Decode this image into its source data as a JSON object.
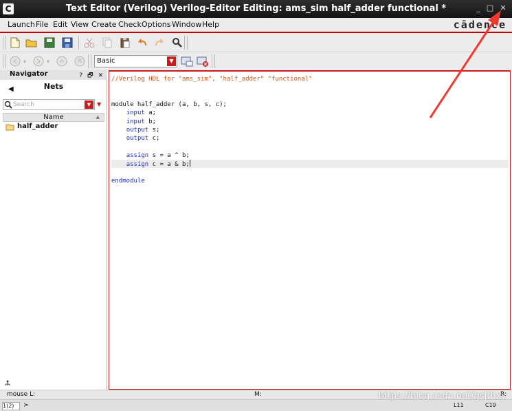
{
  "window": {
    "title": "Text Editor (Verilog) Verilog-Editor Editing: ams_sim half_adder functional *",
    "app_icon": "C"
  },
  "menubar": {
    "items": [
      "Launch",
      "File",
      "Edit",
      "View",
      "Create",
      "Check",
      "Options",
      "Window",
      "Help"
    ],
    "brand": "cādence"
  },
  "toolbar": {
    "view_mode": "Basic"
  },
  "navigator": {
    "title": "Navigator",
    "header_controls": "? 🗗 ✕",
    "section": "Nets",
    "search_placeholder": "Search",
    "column": "Name",
    "items": [
      "half_adder"
    ]
  },
  "editor": {
    "lines": [
      {
        "segments": [
          {
            "t": "//Verilog HDL for \"ams_sim\", \"half_adder\" \"functional\"",
            "c": "comment"
          }
        ]
      },
      {
        "segments": []
      },
      {
        "segments": []
      },
      {
        "segments": [
          {
            "t": "module half_adder (a, b, s, c);",
            "c": "plain"
          }
        ]
      },
      {
        "segments": [
          {
            "t": "    ",
            "c": "plain"
          },
          {
            "t": "input",
            "c": "kw"
          },
          {
            "t": " a;",
            "c": "plain"
          }
        ]
      },
      {
        "segments": [
          {
            "t": "    ",
            "c": "plain"
          },
          {
            "t": "input",
            "c": "kw"
          },
          {
            "t": " b;",
            "c": "plain"
          }
        ]
      },
      {
        "segments": [
          {
            "t": "    ",
            "c": "plain"
          },
          {
            "t": "output",
            "c": "kw"
          },
          {
            "t": " s;",
            "c": "plain"
          }
        ]
      },
      {
        "segments": [
          {
            "t": "    ",
            "c": "plain"
          },
          {
            "t": "output",
            "c": "kw"
          },
          {
            "t": " c;",
            "c": "plain"
          }
        ]
      },
      {
        "segments": []
      },
      {
        "segments": [
          {
            "t": "    ",
            "c": "plain"
          },
          {
            "t": "assign",
            "c": "kw"
          },
          {
            "t": " s = a ^ b;",
            "c": "plain"
          }
        ]
      },
      {
        "segments": [
          {
            "t": "    ",
            "c": "plain"
          },
          {
            "t": "assign",
            "c": "kw"
          },
          {
            "t": " c = a & b;",
            "c": "plain"
          }
        ],
        "current": true
      },
      {
        "segments": []
      },
      {
        "segments": [
          {
            "t": "endmodule",
            "c": "kw"
          }
        ]
      }
    ]
  },
  "status": {
    "mouse_left": "mouse L:",
    "mouse_middle": "M:",
    "mouse_right": "R:",
    "counter": "1(2)",
    "prompt": ">",
    "cursor_pos": "L11",
    "cursor_col": "C19"
  },
  "watermark": "https://blog.csdn.net/gsjthxy",
  "colors": {
    "accent": "#c81b1b",
    "keyword": "#1b2fbf",
    "comment": "#d2571a",
    "annotation_arrow": "#f03a2e"
  }
}
